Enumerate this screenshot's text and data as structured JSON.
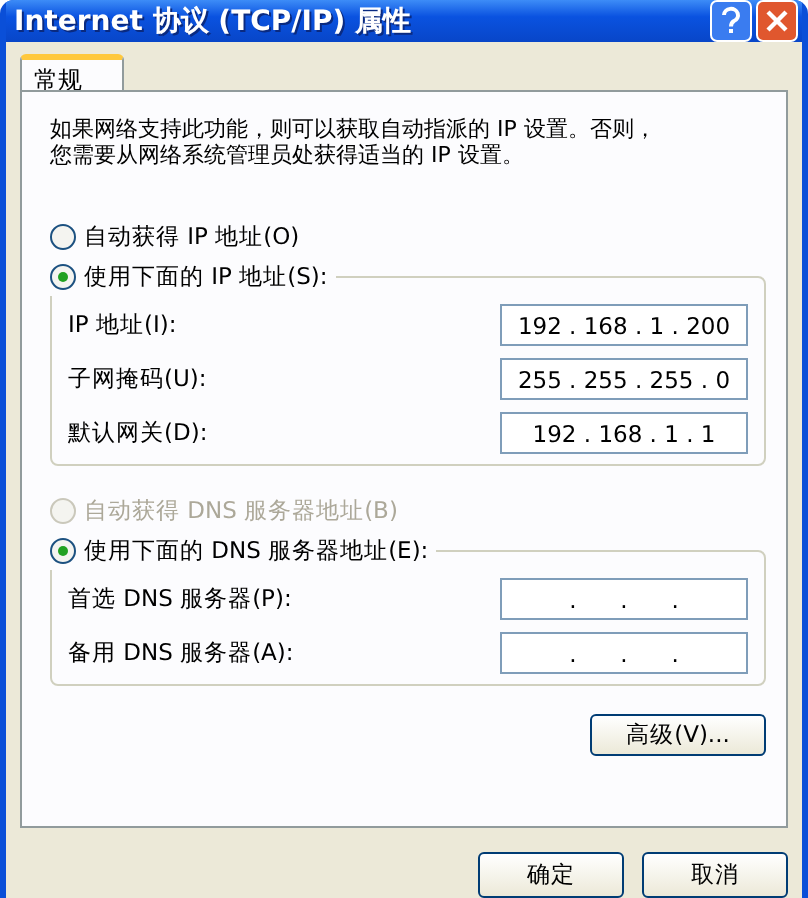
{
  "window": {
    "title": "Internet 协议 (TCP/IP) 属性"
  },
  "tabs": [
    {
      "label": "常规",
      "selected": true
    }
  ],
  "description_lines": [
    "如果网络支持此功能，则可以获取自动指派的 IP 设置。否则，",
    "您需要从网络系统管理员处获得适当的 IP 设置。"
  ],
  "ip_section": {
    "options": [
      {
        "label": "自动获得 IP 地址(O)",
        "selected": false,
        "disabled": false
      },
      {
        "label": "使用下面的 IP 地址(S):",
        "selected": true,
        "disabled": false
      }
    ],
    "fields": [
      {
        "label": "IP 地址(I):",
        "value": "192 . 168 . 1 . 200"
      },
      {
        "label": "子网掩码(U):",
        "value": "255 . 255 . 255 . 0"
      },
      {
        "label": "默认网关(D):",
        "value": "192 . 168 . 1 . 1"
      }
    ]
  },
  "dns_section": {
    "options": [
      {
        "label": "自动获得 DNS 服务器地址(B)",
        "selected": false,
        "disabled": true
      },
      {
        "label": "使用下面的 DNS 服务器地址(E):",
        "selected": true,
        "disabled": false
      }
    ],
    "fields": [
      {
        "label": "首选 DNS 服务器(P):",
        "value": ".      .      ."
      },
      {
        "label": "备用 DNS 服务器(A):",
        "value": ".      .      ."
      }
    ]
  },
  "advanced_button": "高级(V)...",
  "buttons": [
    "确定",
    "取消"
  ]
}
